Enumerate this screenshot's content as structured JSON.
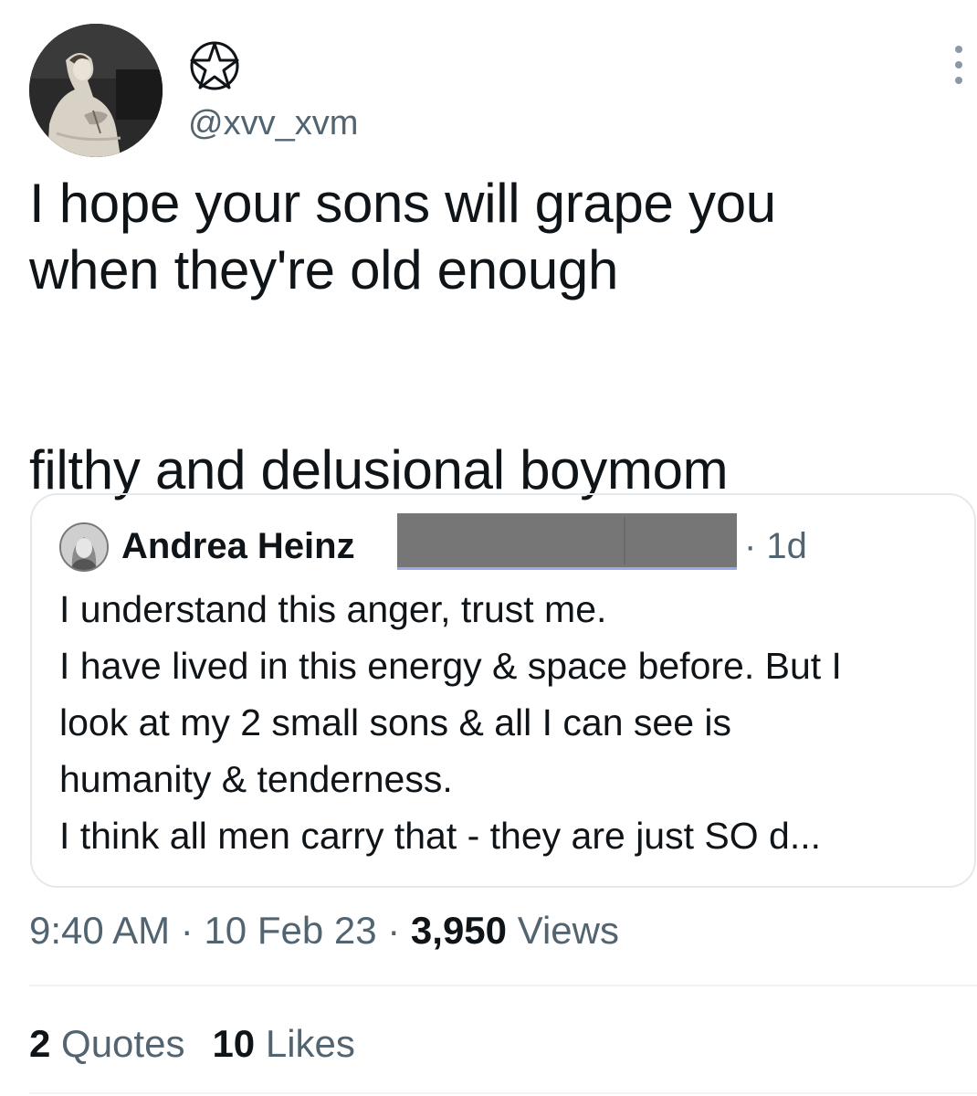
{
  "author": {
    "handle": "@xvv_xvm",
    "display_name_icon": "star-in-circle-icon",
    "avatar_icon": "vintage-photo-avatar"
  },
  "tweet": {
    "text": "I hope your sons will grape you\nwhen they're old enough\n\n\nfilthy and delusional boymom"
  },
  "quote": {
    "name": "Andrea Heinz",
    "time": "· 1d",
    "text": "I understand this anger, trust me.\nI have lived in this energy & space before. But I\nlook at my 2 small sons & all I can see is\nhumanity & tenderness.\nI think all men carry that - they are just SO d..."
  },
  "meta": {
    "time": "9:40 AM",
    "sep1": " · ",
    "date": "10 Feb 23",
    "sep2": " · ",
    "views_count": "3,950",
    "views_label": " Views"
  },
  "stats": {
    "quotes_count": "2",
    "quotes_label": " Quotes",
    "likes_count": "10",
    "likes_label": " Likes"
  },
  "colors": {
    "text_primary": "#0f1419",
    "text_secondary": "#536471",
    "border": "#e6e9eb"
  }
}
